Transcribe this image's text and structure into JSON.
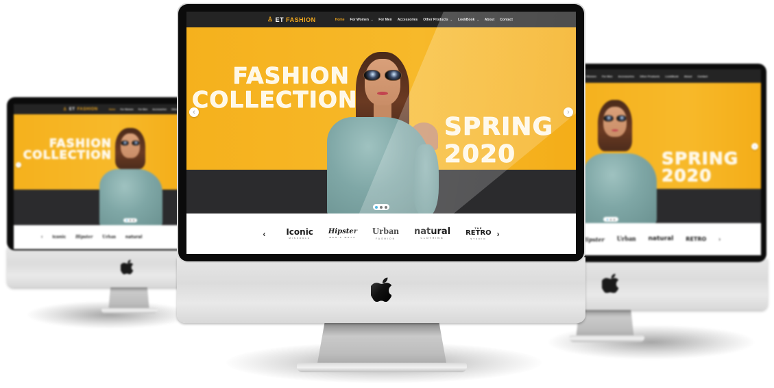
{
  "site": {
    "logo": {
      "icon": "hanger-icon",
      "brand_first": "ET",
      "brand_second": "FASHION"
    },
    "nav": [
      {
        "label": "Home",
        "active": true,
        "dropdown": false
      },
      {
        "label": "For Women",
        "active": false,
        "dropdown": true
      },
      {
        "label": "For Men",
        "active": false,
        "dropdown": false
      },
      {
        "label": "Accessories",
        "active": false,
        "dropdown": false
      },
      {
        "label": "Other Products",
        "active": false,
        "dropdown": true
      },
      {
        "label": "LookBook",
        "active": false,
        "dropdown": true
      },
      {
        "label": "About",
        "active": false,
        "dropdown": false
      },
      {
        "label": "Contact",
        "active": false,
        "dropdown": false
      }
    ],
    "chevron": "⌄",
    "hero": {
      "headline_left": [
        "FASHION",
        "COLLECTION"
      ],
      "headline_right": [
        "SPRING",
        "2020"
      ],
      "prev_icon": "‹",
      "next_icon": "›",
      "slides_total": 3,
      "active_slide": 1
    },
    "brands": {
      "prev_icon": "‹",
      "next_icon": "›",
      "items": [
        {
          "name": "Iconic",
          "sub": "MISSOULA"
        },
        {
          "name": "Hipster",
          "sub": "MEN'S WEAR"
        },
        {
          "name": "Urban",
          "sub": "FASHION"
        },
        {
          "name": "natural",
          "sub": "CLOTHING"
        },
        {
          "name": "RETRO",
          "top": "THE",
          "sub": "STUDIO"
        }
      ]
    }
  },
  "colors": {
    "accent": "#f2a81d",
    "hero_yellow": "#f6b21f",
    "nav_bg": "#242424",
    "dot_active": "#1ea1d9"
  },
  "device": {
    "logo_icon": "apple-logo-icon"
  }
}
